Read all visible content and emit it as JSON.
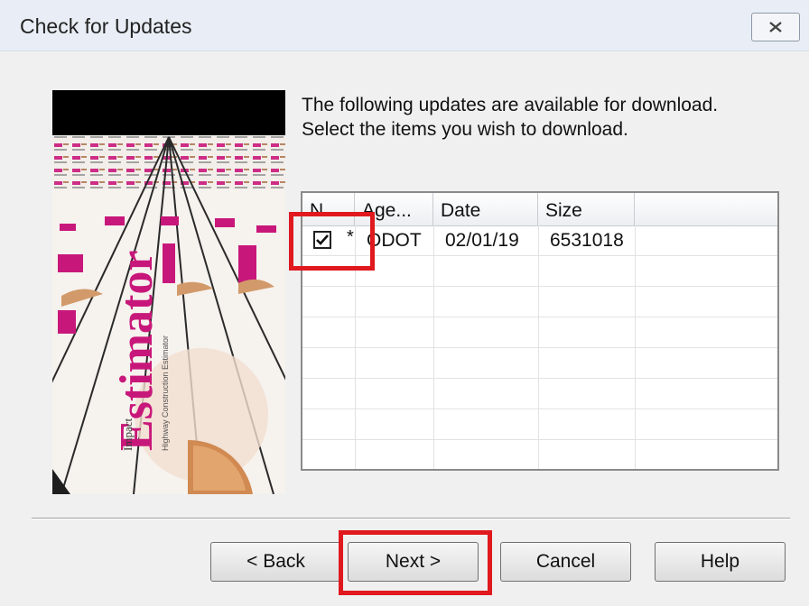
{
  "window": {
    "title": "Check for Updates"
  },
  "instructions": {
    "line1": "The following updates are available for download.",
    "line2": "Select the items you wish to download."
  },
  "list": {
    "columns": [
      "N...",
      "Age...",
      "Date",
      "Size"
    ],
    "rows": [
      {
        "checked": true,
        "name": "*",
        "agency": "ODOT",
        "date": "02/01/19",
        "size": "6531018"
      }
    ]
  },
  "buttons": {
    "back": "< Back",
    "next": "Next >",
    "cancel": "Cancel",
    "help": "Help"
  },
  "splash": {
    "brand_text": "Estimator",
    "subtitle_text": "Highway Construction Estimator",
    "prefix_text": "Impact"
  },
  "colors": {
    "highlight": "#e0191e",
    "brand": "#c8177a",
    "titlebar": "#e9eef6"
  }
}
